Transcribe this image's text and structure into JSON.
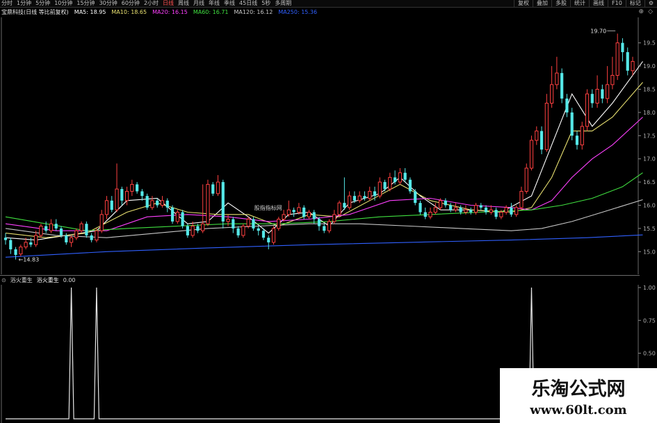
{
  "toolbar": {
    "periods": [
      "分时",
      "1分钟",
      "5分钟",
      "10分钟",
      "15分钟",
      "30分钟",
      "60分钟",
      "2小时",
      "日线",
      "周线",
      "月线",
      "年线",
      "季线",
      "45日线",
      "5秒",
      "多周期"
    ],
    "active_period": "日线",
    "right_buttons": [
      "复权",
      "叠加",
      "多股",
      "统计",
      "画线",
      "F10",
      "标记",
      "⚙"
    ]
  },
  "legend": {
    "title": "宝鼎科技(日线 等比前复权)",
    "items": [
      {
        "label": "MA5: 18.95",
        "color": "#ffffff"
      },
      {
        "label": "MA10: 18.65",
        "color": "#e8e070"
      },
      {
        "label": "MA20: 16.15",
        "color": "#ff40ff"
      },
      {
        "label": "MA60: 16.71",
        "color": "#40e040"
      },
      {
        "label": "MA120: 16.12",
        "color": "#c8c8c8"
      },
      {
        "label": "MA250: 15.36",
        "color": "#3060ff"
      }
    ]
  },
  "watermark": {
    "title": "乐淘公式网",
    "url": "www.60lt.com"
  },
  "indicator": {
    "name": "浴火重生",
    "series_label": "浴火重生",
    "value": "0.00"
  },
  "colors": {
    "up": "#ff4040",
    "down": "#55e8e8",
    "grid": "#404040"
  },
  "chart_data": {
    "type": "candlestick",
    "title": "宝鼎科技(日线 等比前复权)",
    "ylim": [
      14.6,
      19.9
    ],
    "yticks": [
      15.0,
      15.5,
      16.0,
      16.5,
      17.0,
      17.5,
      18.0,
      18.5,
      19.0,
      19.5
    ],
    "annotations": [
      {
        "text": "19.70",
        "value": 19.7,
        "type": "high"
      },
      {
        "text": "←14.83",
        "value": 14.83,
        "type": "low"
      },
      {
        "text": "股指指标网",
        "value": 15.95,
        "type": "label"
      }
    ],
    "candles": [
      [
        15.3,
        15.25,
        15.4,
        15.15
      ],
      [
        15.25,
        15.05,
        15.3,
        14.95
      ],
      [
        15.05,
        14.93,
        15.1,
        14.83
      ],
      [
        14.95,
        15.1,
        15.15,
        14.9
      ],
      [
        15.1,
        15.2,
        15.3,
        15.05
      ],
      [
        15.2,
        15.15,
        15.3,
        15.1
      ],
      [
        15.15,
        15.35,
        15.45,
        15.1
      ],
      [
        15.35,
        15.55,
        15.6,
        15.3
      ],
      [
        15.55,
        15.45,
        15.65,
        15.4
      ],
      [
        15.45,
        15.6,
        15.7,
        15.4
      ],
      [
        15.6,
        15.5,
        15.7,
        15.45
      ],
      [
        15.5,
        15.35,
        15.55,
        15.3
      ],
      [
        15.35,
        15.2,
        15.4,
        15.15
      ],
      [
        15.2,
        15.3,
        15.35,
        15.1
      ],
      [
        15.3,
        15.45,
        15.5,
        15.25
      ],
      [
        15.45,
        15.6,
        15.65,
        15.4
      ],
      [
        15.6,
        15.35,
        15.65,
        15.3
      ],
      [
        15.35,
        15.25,
        15.4,
        15.2
      ],
      [
        15.25,
        15.45,
        15.5,
        15.2
      ],
      [
        15.45,
        15.8,
        15.9,
        15.4
      ],
      [
        15.8,
        16.1,
        16.2,
        15.7
      ],
      [
        16.1,
        15.9,
        16.2,
        15.85
      ],
      [
        15.9,
        16.35,
        16.9,
        15.85
      ],
      [
        16.35,
        16.1,
        16.4,
        16.0
      ],
      [
        16.1,
        16.3,
        16.4,
        16.0
      ],
      [
        16.3,
        16.45,
        16.55,
        16.2
      ],
      [
        16.45,
        16.3,
        16.5,
        16.25
      ],
      [
        16.3,
        16.2,
        16.35,
        16.1
      ],
      [
        16.2,
        15.95,
        16.25,
        15.9
      ],
      [
        15.95,
        16.1,
        16.2,
        15.9
      ],
      [
        16.1,
        16.0,
        16.15,
        15.95
      ],
      [
        16.0,
        16.1,
        16.2,
        15.95
      ],
      [
        16.1,
        15.95,
        16.15,
        15.85
      ],
      [
        15.95,
        15.65,
        16.0,
        15.6
      ],
      [
        15.65,
        15.85,
        15.9,
        15.6
      ],
      [
        15.85,
        15.55,
        15.9,
        15.5
      ],
      [
        15.55,
        15.35,
        15.6,
        15.3
      ],
      [
        15.35,
        15.55,
        15.65,
        15.3
      ],
      [
        15.55,
        15.45,
        15.6,
        15.4
      ],
      [
        15.45,
        15.6,
        16.45,
        15.4
      ],
      [
        15.6,
        16.45,
        16.55,
        15.55
      ],
      [
        16.45,
        16.25,
        16.5,
        16.2
      ],
      [
        16.25,
        16.5,
        16.65,
        16.2
      ],
      [
        16.5,
        15.65,
        16.55,
        15.5
      ],
      [
        15.65,
        15.7,
        15.8,
        15.55
      ],
      [
        15.7,
        15.5,
        15.75,
        15.4
      ],
      [
        15.5,
        15.35,
        15.55,
        15.3
      ],
      [
        15.35,
        15.55,
        15.6,
        15.3
      ],
      [
        15.55,
        15.7,
        15.75,
        15.5
      ],
      [
        15.7,
        15.5,
        15.75,
        15.45
      ],
      [
        15.5,
        15.45,
        15.55,
        15.35
      ],
      [
        15.45,
        15.3,
        15.5,
        15.25
      ],
      [
        15.3,
        15.2,
        15.35,
        15.05
      ],
      [
        15.2,
        15.5,
        15.55,
        15.15
      ],
      [
        15.5,
        15.7,
        15.75,
        15.45
      ],
      [
        15.7,
        15.8,
        15.9,
        15.65
      ],
      [
        15.8,
        15.9,
        16.1,
        15.75
      ],
      [
        15.9,
        15.85,
        15.95,
        15.75
      ],
      [
        15.85,
        15.95,
        16.05,
        15.8
      ],
      [
        15.95,
        15.75,
        16.0,
        15.7
      ],
      [
        15.75,
        15.85,
        15.9,
        15.7
      ],
      [
        15.85,
        15.7,
        15.9,
        15.6
      ],
      [
        15.7,
        15.55,
        15.75,
        15.45
      ],
      [
        15.55,
        15.45,
        15.6,
        15.4
      ],
      [
        15.45,
        15.65,
        15.7,
        15.4
      ],
      [
        15.65,
        15.8,
        15.9,
        15.6
      ],
      [
        15.8,
        16.05,
        16.1,
        15.75
      ],
      [
        16.05,
        15.95,
        16.6,
        15.9
      ],
      [
        15.95,
        16.2,
        16.3,
        15.9
      ],
      [
        16.2,
        16.1,
        16.3,
        16.05
      ],
      [
        16.1,
        16.2,
        16.3,
        16.05
      ],
      [
        16.2,
        16.15,
        16.3,
        16.1
      ],
      [
        16.15,
        16.3,
        16.4,
        16.1
      ],
      [
        16.3,
        16.2,
        16.4,
        16.1
      ],
      [
        16.2,
        16.5,
        16.6,
        16.15
      ],
      [
        16.5,
        16.35,
        16.55,
        16.3
      ],
      [
        16.35,
        16.6,
        16.7,
        16.3
      ],
      [
        16.6,
        16.5,
        16.75,
        16.45
      ],
      [
        16.5,
        16.7,
        16.8,
        16.45
      ],
      [
        16.7,
        16.55,
        16.8,
        16.5
      ],
      [
        16.55,
        16.3,
        16.6,
        16.25
      ],
      [
        16.3,
        16.05,
        16.35,
        16.0
      ],
      [
        16.05,
        15.85,
        16.1,
        15.8
      ],
      [
        15.85,
        15.75,
        15.95,
        15.7
      ],
      [
        15.75,
        15.85,
        15.95,
        15.7
      ],
      [
        15.85,
        15.95,
        16.05,
        15.8
      ],
      [
        15.95,
        16.1,
        16.15,
        15.9
      ],
      [
        16.1,
        16.0,
        16.15,
        15.95
      ],
      [
        16.0,
        15.9,
        16.05,
        15.85
      ],
      [
        15.9,
        15.95,
        16.05,
        15.85
      ],
      [
        15.95,
        15.85,
        16.0,
        15.8
      ],
      [
        15.85,
        15.9,
        16.0,
        15.8
      ],
      [
        15.9,
        15.85,
        15.95,
        15.8
      ],
      [
        15.85,
        16.0,
        16.05,
        15.8
      ],
      [
        16.0,
        15.95,
        16.05,
        15.9
      ],
      [
        15.95,
        15.85,
        16.0,
        15.8
      ],
      [
        15.85,
        15.9,
        16.0,
        15.8
      ],
      [
        15.9,
        15.75,
        15.95,
        15.7
      ],
      [
        15.75,
        15.85,
        15.9,
        15.7
      ],
      [
        15.85,
        15.95,
        16.0,
        15.8
      ],
      [
        15.95,
        15.8,
        16.05,
        15.75
      ],
      [
        15.8,
        15.95,
        16.0,
        15.75
      ],
      [
        15.95,
        16.3,
        16.4,
        15.9
      ],
      [
        16.3,
        16.8,
        16.9,
        16.25
      ],
      [
        16.8,
        17.4,
        17.5,
        16.75
      ],
      [
        17.4,
        17.6,
        17.7,
        17.3
      ],
      [
        17.6,
        17.2,
        17.7,
        17.1
      ],
      [
        17.2,
        18.2,
        18.4,
        17.15
      ],
      [
        18.2,
        18.6,
        19.0,
        18.1
      ],
      [
        18.6,
        18.85,
        19.2,
        18.5
      ],
      [
        18.85,
        18.3,
        18.95,
        18.2
      ],
      [
        18.3,
        18.0,
        18.4,
        17.9
      ],
      [
        18.0,
        17.5,
        18.1,
        17.4
      ],
      [
        17.5,
        17.3,
        17.6,
        17.2
      ],
      [
        17.3,
        17.7,
        17.8,
        17.2
      ],
      [
        17.7,
        18.4,
        18.5,
        17.6
      ],
      [
        18.4,
        18.2,
        18.5,
        18.1
      ],
      [
        18.2,
        18.5,
        18.8,
        18.1
      ],
      [
        18.5,
        18.3,
        18.6,
        18.2
      ],
      [
        18.3,
        18.6,
        19.0,
        18.2
      ],
      [
        18.6,
        18.8,
        19.2,
        18.5
      ],
      [
        18.8,
        19.5,
        19.7,
        18.7
      ],
      [
        19.5,
        19.3,
        19.6,
        19.1
      ],
      [
        19.3,
        18.9,
        19.4,
        18.8
      ],
      [
        18.9,
        19.1,
        19.2,
        18.8
      ]
    ],
    "ma": [
      {
        "name": "MA5",
        "color": "#ffffff",
        "points": [
          [
            0,
            15.3
          ],
          [
            6,
            15.25
          ],
          [
            12,
            15.35
          ],
          [
            18,
            15.45
          ],
          [
            24,
            16.1
          ],
          [
            30,
            16.15
          ],
          [
            36,
            15.6
          ],
          [
            40,
            15.65
          ],
          [
            44,
            16.05
          ],
          [
            48,
            15.75
          ],
          [
            52,
            15.4
          ],
          [
            56,
            15.8
          ],
          [
            60,
            15.85
          ],
          [
            64,
            15.55
          ],
          [
            68,
            16.05
          ],
          [
            74,
            16.25
          ],
          [
            78,
            16.6
          ],
          [
            82,
            16.2
          ],
          [
            86,
            15.9
          ],
          [
            92,
            15.9
          ],
          [
            98,
            15.85
          ],
          [
            104,
            16.2
          ],
          [
            108,
            17.3
          ],
          [
            112,
            18.4
          ],
          [
            116,
            17.7
          ],
          [
            120,
            18.2
          ],
          [
            126,
            19.1
          ]
        ]
      },
      {
        "name": "MA10",
        "color": "#e8e070",
        "points": [
          [
            0,
            15.4
          ],
          [
            8,
            15.3
          ],
          [
            16,
            15.4
          ],
          [
            24,
            15.85
          ],
          [
            30,
            16.05
          ],
          [
            36,
            15.85
          ],
          [
            42,
            15.8
          ],
          [
            48,
            15.8
          ],
          [
            54,
            15.55
          ],
          [
            60,
            15.8
          ],
          [
            66,
            15.75
          ],
          [
            72,
            16.1
          ],
          [
            78,
            16.45
          ],
          [
            84,
            16.1
          ],
          [
            92,
            15.9
          ],
          [
            100,
            15.85
          ],
          [
            104,
            15.95
          ],
          [
            108,
            16.6
          ],
          [
            112,
            17.6
          ],
          [
            116,
            17.6
          ],
          [
            120,
            17.9
          ],
          [
            126,
            18.65
          ]
        ]
      },
      {
        "name": "MA20",
        "color": "#ff40ff",
        "points": [
          [
            0,
            15.6
          ],
          [
            10,
            15.45
          ],
          [
            20,
            15.45
          ],
          [
            28,
            15.75
          ],
          [
            36,
            15.8
          ],
          [
            44,
            15.75
          ],
          [
            52,
            15.65
          ],
          [
            60,
            15.7
          ],
          [
            68,
            15.8
          ],
          [
            76,
            16.1
          ],
          [
            84,
            16.15
          ],
          [
            92,
            16.0
          ],
          [
            100,
            15.95
          ],
          [
            104,
            15.9
          ],
          [
            108,
            16.1
          ],
          [
            112,
            16.6
          ],
          [
            116,
            17.0
          ],
          [
            120,
            17.3
          ],
          [
            126,
            17.9
          ]
        ]
      },
      {
        "name": "MA60",
        "color": "#40e040",
        "points": [
          [
            0,
            15.75
          ],
          [
            8,
            15.6
          ],
          [
            16,
            15.45
          ],
          [
            24,
            15.5
          ],
          [
            34,
            15.55
          ],
          [
            44,
            15.6
          ],
          [
            54,
            15.6
          ],
          [
            64,
            15.65
          ],
          [
            74,
            15.75
          ],
          [
            84,
            15.8
          ],
          [
            94,
            15.85
          ],
          [
            104,
            15.9
          ],
          [
            110,
            16.0
          ],
          [
            116,
            16.15
          ],
          [
            122,
            16.4
          ],
          [
            126,
            16.7
          ]
        ]
      },
      {
        "name": "MA120",
        "color": "#c8c8c8",
        "points": [
          [
            0,
            15.5
          ],
          [
            10,
            15.35
          ],
          [
            20,
            15.3
          ],
          [
            30,
            15.4
          ],
          [
            40,
            15.5
          ],
          [
            50,
            15.55
          ],
          [
            60,
            15.6
          ],
          [
            70,
            15.6
          ],
          [
            80,
            15.55
          ],
          [
            90,
            15.5
          ],
          [
            100,
            15.45
          ],
          [
            106,
            15.5
          ],
          [
            112,
            15.65
          ],
          [
            118,
            15.85
          ],
          [
            126,
            16.12
          ]
        ]
      },
      {
        "name": "MA250",
        "color": "#3060ff",
        "points": [
          [
            0,
            14.88
          ],
          [
            20,
            15.0
          ],
          [
            40,
            15.08
          ],
          [
            60,
            15.15
          ],
          [
            80,
            15.2
          ],
          [
            100,
            15.25
          ],
          [
            115,
            15.3
          ],
          [
            126,
            15.36
          ]
        ]
      }
    ],
    "indicator": {
      "name": "浴火重生",
      "ylim": [
        0,
        1
      ],
      "yticks": [
        0.0,
        0.25,
        0.5,
        0.75,
        1.0
      ],
      "signals": [
        13,
        18,
        104
      ]
    }
  }
}
